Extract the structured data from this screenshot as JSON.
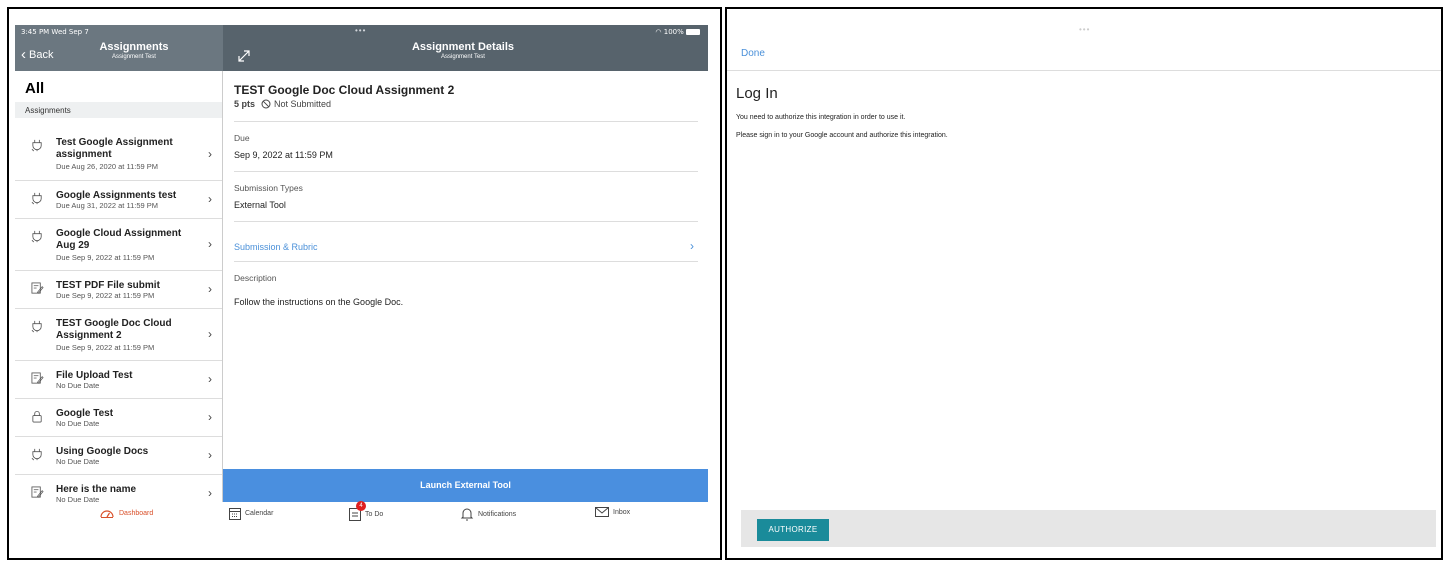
{
  "status_bar": {
    "time": "3:45 PM  Wed Sep 7",
    "battery": "100%"
  },
  "nav": {
    "back_label": "Back",
    "list_title": "Assignments",
    "list_subtitle": "Assignment Test",
    "detail_title": "Assignment Details",
    "detail_subtitle": "Assignment Test"
  },
  "list": {
    "heading": "All",
    "section": "Assignments",
    "items": [
      {
        "title": "Test Google Assignment assignment",
        "due": "Due Aug 26, 2020 at 11:59 PM",
        "icon": "external-tool-icon"
      },
      {
        "title": "Google Assignments test",
        "due": "Due Aug 31, 2022 at 11:59 PM",
        "icon": "external-tool-icon"
      },
      {
        "title": "Google Cloud Assignment Aug 29",
        "due": "Due Sep 9, 2022 at 11:59 PM",
        "icon": "external-tool-icon"
      },
      {
        "title": "TEST PDF File submit",
        "due": "Due Sep 9, 2022 at 11:59 PM",
        "icon": "assignment-icon"
      },
      {
        "title": "TEST Google Doc Cloud Assignment 2",
        "due": "Due Sep 9, 2022 at 11:59 PM",
        "icon": "external-tool-icon"
      },
      {
        "title": "File Upload Test",
        "due": "No Due Date",
        "icon": "assignment-icon"
      },
      {
        "title": "Google Test",
        "due": "No Due Date",
        "icon": "lock-icon"
      },
      {
        "title": "Using Google Docs",
        "due": "No Due Date",
        "icon": "external-tool-icon"
      },
      {
        "title": "Here is the name",
        "due": "No Due Date",
        "icon": "assignment-icon"
      }
    ]
  },
  "detail": {
    "title": "TEST Google Doc Cloud Assignment 2",
    "points": "5 pts",
    "status": "Not Submitted",
    "due_label": "Due",
    "due_value": "Sep 9, 2022 at 11:59 PM",
    "types_label": "Submission Types",
    "types_value": "External Tool",
    "rubric_link": "Submission & Rubric",
    "description_label": "Description",
    "description": "Follow the instructions on the Google Doc.",
    "launch_button": "Launch External Tool"
  },
  "tabs": [
    {
      "label": "Dashboard",
      "icon": "dashboard-icon"
    },
    {
      "label": "Calendar",
      "icon": "calendar-icon"
    },
    {
      "label": "To Do",
      "icon": "todo-icon",
      "badge": "4"
    },
    {
      "label": "Notifications",
      "icon": "bell-icon"
    },
    {
      "label": "Inbox",
      "icon": "mail-icon"
    }
  ],
  "auth": {
    "done": "Done",
    "title": "Log In",
    "line1": "You need to authorize this integration in order to use it.",
    "line2": "Please sign in to your Google account and authorize this integration.",
    "button": "AUTHORIZE"
  },
  "colors": {
    "nav_list": "#6b7780",
    "nav_detail": "#57636c",
    "accent_blue": "#4a8fdf",
    "link": "#4a90d9",
    "active_tab": "#d9502a",
    "authorize": "#1a8b9a"
  }
}
